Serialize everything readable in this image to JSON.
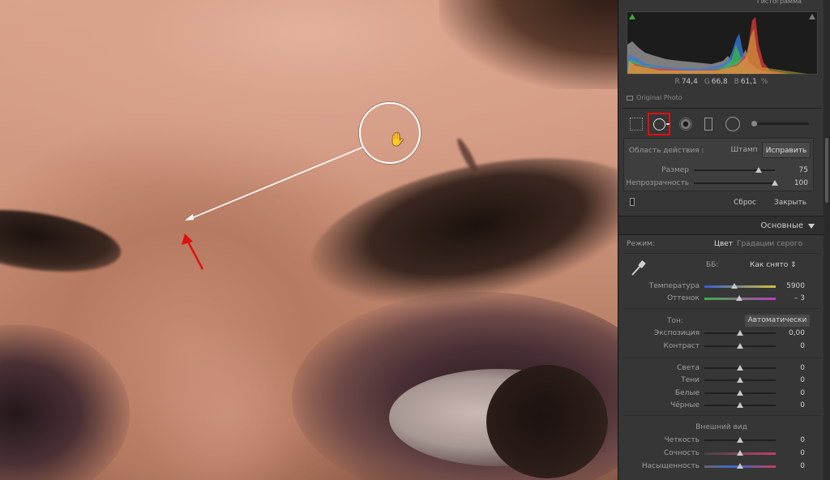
{
  "histogram": {
    "title": "Гистограмма",
    "readout": {
      "r_label": "R",
      "r": "74,4",
      "g_label": "G",
      "g": "66,8",
      "b_label": "B",
      "b": "61,1",
      "unit": "%"
    },
    "original_photo": "Original Photo"
  },
  "tools": [
    "crop-overlay",
    "spot-removal",
    "red-eye",
    "graduated-filter",
    "radial-filter",
    "adjustment-brush"
  ],
  "spot_removal": {
    "mode_label": "Область действия :",
    "modes": {
      "clone": "Штамп",
      "heal": "Исправить"
    },
    "active_mode": "heal",
    "sliders": [
      {
        "label": "Размер",
        "value": "75",
        "pos": 0.8
      },
      {
        "label": "Непрозрачность",
        "value": "100",
        "pos": 1.0
      }
    ],
    "reset": "Сброс",
    "close": "Закрыть"
  },
  "basic": {
    "title": "Основные",
    "treatment_label": "Режим:",
    "treatment_color": "Цвет",
    "treatment_bw": "Градации серого",
    "wb_label": "ББ:",
    "wb_value": "Как снято ⇕",
    "wb": [
      {
        "label": "Температура",
        "value": "5900",
        "pos": 0.42,
        "track": "temp"
      },
      {
        "label": "Оттенок",
        "value": "– 3",
        "pos": 0.49,
        "track": "tint"
      }
    ],
    "tone_label": "Тон:",
    "auto": "Автоматически",
    "tone": [
      {
        "label": "Экспозиция",
        "value": "0,00",
        "pos": 0.5
      },
      {
        "label": "Контраст",
        "value": "0",
        "pos": 0.5
      }
    ],
    "tone2": [
      {
        "label": "Света",
        "value": "0",
        "pos": 0.5
      },
      {
        "label": "Тени",
        "value": "0",
        "pos": 0.5
      },
      {
        "label": "Белые",
        "value": "0",
        "pos": 0.5
      },
      {
        "label": "Чёрные",
        "value": "0",
        "pos": 0.5
      }
    ],
    "presence_label": "Внешний вид",
    "presence": [
      {
        "label": "Четкость",
        "value": "0",
        "pos": 0.5
      },
      {
        "label": "Сочность",
        "value": "0",
        "pos": 0.5,
        "track": "vib"
      },
      {
        "label": "Насыщенность",
        "value": "0",
        "pos": 0.5,
        "track": "sat"
      }
    ]
  },
  "colors": {
    "accent_red": "#e01010",
    "panel": "#363636"
  }
}
